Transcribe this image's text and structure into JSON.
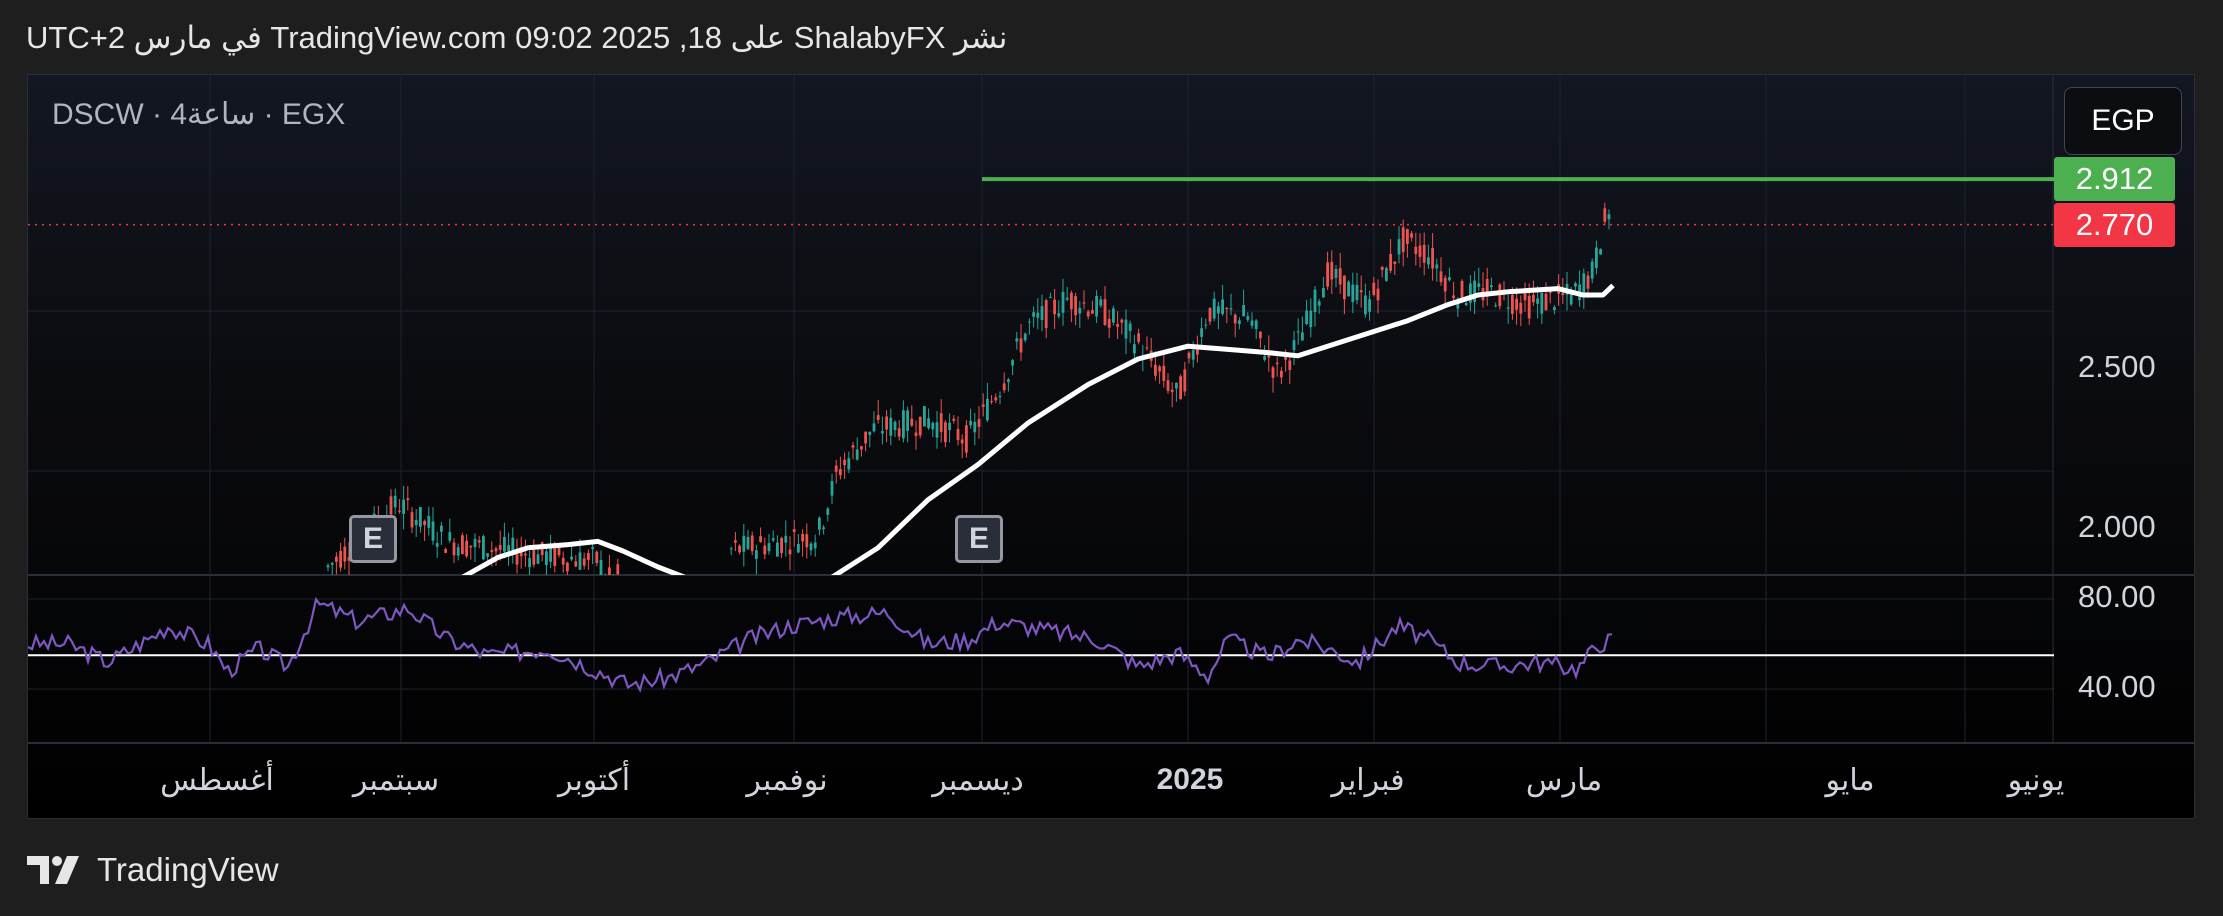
{
  "header": {
    "published_text": "نشر ShalabyFX على TradingView.com 09:02 2025 ,18 في مارس UTC+2"
  },
  "symbol": {
    "label": "DSCW · 4ساعة · EGX"
  },
  "currency": {
    "label": "EGP"
  },
  "price_tags": [
    {
      "value": "2.912",
      "color": "#4caf50"
    },
    {
      "value": "2.770",
      "color": "#f23645"
    }
  ],
  "footer": {
    "brand": "TradingView"
  },
  "earnings_marker": {
    "label": "E"
  },
  "colors": {
    "up_candle": "#26a69a",
    "down_candle": "#ef5350",
    "moving_average": "#ffffff",
    "rsi": "#7e57c2",
    "resistance_line": "#4caf50",
    "last_price_line": "#f23645"
  },
  "chart_data": [
    {
      "type": "candlestick",
      "title": "DSCW · 4ساعة · EGX",
      "price_axis_ticks": [
        "2.912",
        "2.770",
        "2.500",
        "2.000"
      ],
      "time_axis_ticks": [
        "أغسطس",
        "سبتمبر",
        "أكتوبر",
        "نوفمبر",
        "ديسمبر",
        "2025",
        "فبراير",
        "مارس",
        "مايو",
        "يونيو"
      ],
      "price_axis_tick_values": [
        2.5,
        2.0
      ],
      "ylim": [
        1.68,
        3.1
      ],
      "price_series": {
        "x": [
          "أغسطس",
          "سبتمبر",
          "أكتوبر",
          "نوفمبر",
          "ديسمبر",
          "2025",
          "فبراير",
          "مارس"
        ],
        "approx_close": [
          1.69,
          1.88,
          1.68,
          1.69,
          2.15,
          2.33,
          2.5,
          2.62
        ]
      },
      "moving_average": {
        "x": [
          "سبتمبر",
          "أكتوبر",
          "نوفمبر",
          "ديسمبر",
          "2025",
          "فبراير",
          "مارس"
        ],
        "values": [
          1.76,
          1.72,
          1.7,
          2.2,
          2.37,
          2.55,
          2.55
        ]
      },
      "resistance_level": 2.912,
      "last_price": 2.77,
      "earnings_events": [
        "سبتمبر",
        "ديسمبر"
      ]
    },
    {
      "type": "line",
      "title": "",
      "ylim": [
        20,
        100
      ],
      "y_ticks": [
        "80.00",
        "40.00"
      ],
      "reference_line": 55,
      "series": [
        {
          "x": [
            "أغسطس",
            "سبتمبر",
            "أكتوبر",
            "نوفمبر",
            "ديسمبر",
            "2025",
            "فبراير",
            "مارس"
          ],
          "values": [
            58,
            72,
            40,
            65,
            62,
            50,
            60,
            62
          ]
        }
      ]
    }
  ]
}
